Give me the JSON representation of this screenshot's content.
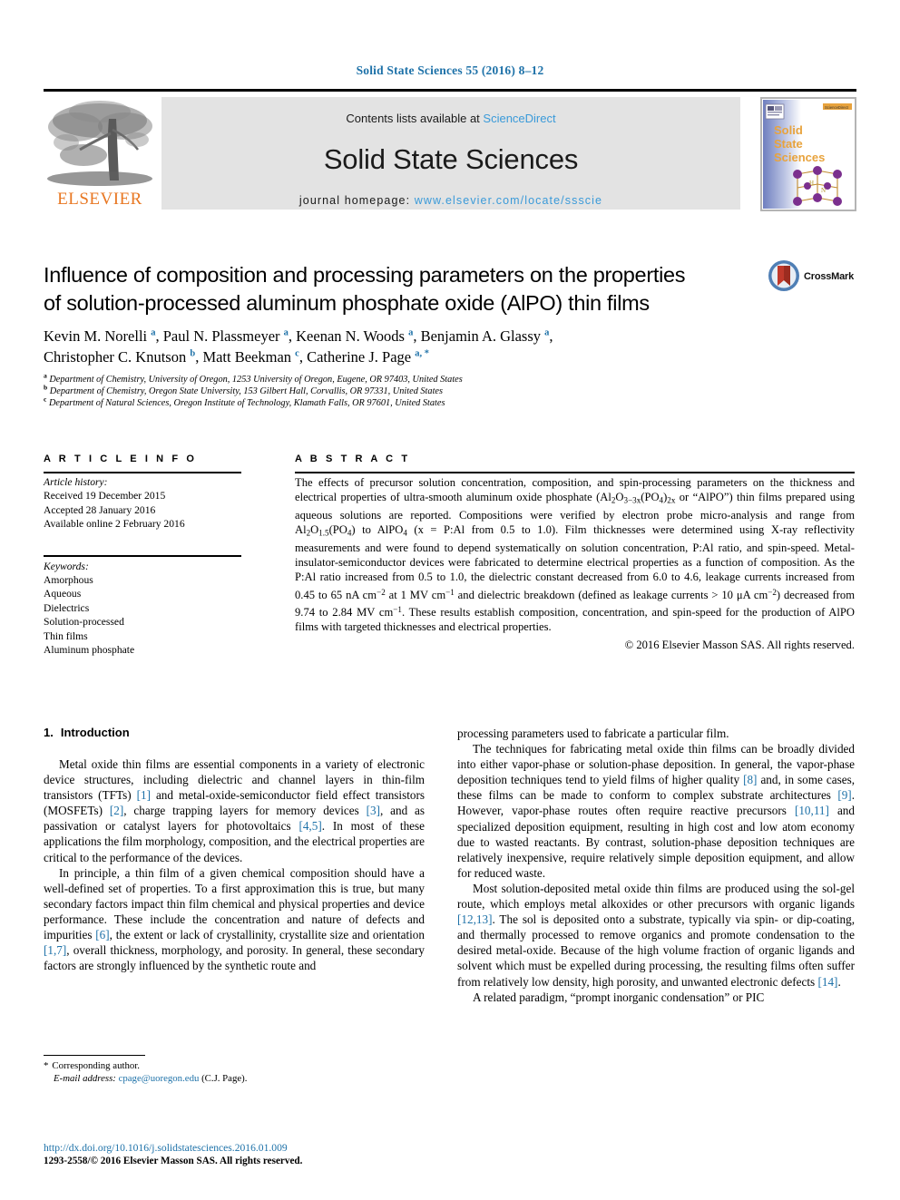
{
  "running_head": "Solid State Sciences 55 (2016) 8–12",
  "banner": {
    "contents_prefix": "Contents lists available at ",
    "sciencedirect": "ScienceDirect",
    "journal_name": "Solid State Sciences",
    "homepage_prefix": "journal homepage: ",
    "homepage_url": "www.elsevier.com/locate/ssscie",
    "publisher": "ELSEVIER",
    "cover_title_lines": [
      "Solid",
      "State",
      "Sciences"
    ],
    "link_color": "#3a9ad9",
    "publisher_color": "#e87722"
  },
  "article": {
    "title_line1": "Influence of composition and processing parameters on the properties",
    "title_line2": "of solution-processed aluminum phosphate oxide (AlPO) thin films",
    "crossmark_label": "CrossMark",
    "authors_line1": "Kevin M. Norelli <sup>a</sup>, Paul N. Plassmeyer <sup>a</sup>, Keenan N. Woods <sup>a</sup>, Benjamin A. Glassy <sup>a</sup>,",
    "authors_line2": "Christopher C. Knutson <sup>b</sup>, Matt Beekman <sup>c</sup>, Catherine J. Page <sup>a, *</sup>",
    "affiliations": [
      "<sup>a</sup> Department of Chemistry, University of Oregon, 1253 University of Oregon, Eugene, OR 97403, United States",
      "<sup>b</sup> Department of Chemistry, Oregon State University, 153 Gilbert Hall, Corvallis, OR 97331, United States",
      "<sup>c</sup> Department of Natural Sciences, Oregon Institute of Technology, Klamath Falls, OR 97601, United States"
    ]
  },
  "article_info": {
    "heading": "A R T I C L E  I N F O",
    "history_label": "Article history:",
    "history": [
      "Received 19 December 2015",
      "Accepted 28 January 2016",
      "Available online 2 February 2016"
    ],
    "keywords_label": "Keywords:",
    "keywords": [
      "Amorphous",
      "Aqueous",
      "Dielectrics",
      "Solution-processed",
      "Thin films",
      "Aluminum phosphate"
    ]
  },
  "abstract": {
    "heading": "A B S T R A C T",
    "body": "The effects of precursor solution concentration, composition, and spin-processing parameters on the thickness and electrical properties of ultra-smooth aluminum oxide phosphate (Al<sub>2</sub>O<sub>3&minus;3x</sub>(PO<sub>4</sub>)<sub>2x</sub> or “AlPO”) thin films prepared using aqueous solutions are reported. Compositions were verified by electron probe micro-analysis and range from Al<sub>2</sub>O<sub>1.5</sub>(PO<sub>4</sub>) to AlPO<sub>4</sub> (x = P:Al from 0.5 to 1.0). Film thicknesses were determined using X-ray reflectivity measurements and were found to depend systematically on solution concentration, P:Al ratio, and spin-speed. Metal-insulator-semiconductor devices were fabricated to determine electrical properties as a function of composition. As the P:Al ratio increased from 0.5 to 1.0, the dielectric constant decreased from 6.0 to 4.6, leakage currents increased from 0.45 to 65 nA cm<sup class=\"num\">&minus;2</sup> at 1 MV cm<sup class=\"num\">&minus;1</sup> and dielectric breakdown (defined as leakage currents > 10 μA cm<sup class=\"num\">&minus;2</sup>) decreased from 9.74 to 2.84 MV cm<sup class=\"num\">&minus;1</sup>. These results establish composition, concentration, and spin-speed for the production of AlPO films with targeted thicknesses and electrical properties.",
    "copyright": "© 2016 Elsevier Masson SAS. All rights reserved."
  },
  "section": {
    "number": "1.",
    "heading": "Introduction"
  },
  "paragraphs_left": [
    "Metal oxide thin films are essential components in a variety of electronic device structures, including dielectric and channel layers in thin-film transistors (TFTs) <span class=\"ref\">[1]</span> and metal-oxide-semiconductor field effect transistors (MOSFETs) <span class=\"ref\">[2]</span>, charge trapping layers for memory devices <span class=\"ref\">[3]</span>, and as passivation or catalyst layers for photovoltaics <span class=\"ref\">[4,5]</span>. In most of these applications the film morphology, composition, and the electrical properties are critical to the performance of the devices.",
    "In principle, a thin film of a given chemical composition should have a well-defined set of properties. To a first approximation this is true, but many secondary factors impact thin film chemical and physical properties and device performance. These include the concentration and nature of defects and impurities <span class=\"ref\">[6]</span>, the extent or lack of crystallinity, crystallite size and orientation <span class=\"ref\">[1,7]</span>, overall thickness, morphology, and porosity. In general, these secondary factors are strongly influenced by the synthetic route and"
  ],
  "paragraphs_right": [
    "processing parameters used to fabricate a particular film.",
    "The techniques for fabricating metal oxide thin films can be broadly divided into either vapor-phase or solution-phase deposition. In general, the vapor-phase deposition techniques tend to yield films of higher quality <span class=\"ref\">[8]</span> and, in some cases, these films can be made to conform to complex substrate architectures <span class=\"ref\">[9]</span>. However, vapor-phase routes often require reactive precursors <span class=\"ref\">[10,11]</span> and specialized deposition equipment, resulting in high cost and low atom economy due to wasted reactants. By contrast, solution-phase deposition techniques are relatively inexpensive, require relatively simple deposition equipment, and allow for reduced waste.",
    "Most solution-deposited metal oxide thin films are produced using the sol-gel route, which employs metal alkoxides or other precursors with organic ligands <span class=\"ref\">[12,13]</span>. The sol is deposited onto a substrate, typically via spin- or dip-coating, and thermally processed to remove organics and promote condensation to the desired metal-oxide. Because of the high volume fraction of organic ligands and solvent which must be expelled during processing, the resulting films often suffer from relatively low density, high porosity, and unwanted electronic defects <span class=\"ref\">[14]</span>.",
    "A related paradigm, “prompt inorganic condensation” or PIC"
  ],
  "footnote": {
    "star": "*",
    "corresponding": "Corresponding author.",
    "email_label": "E-mail address:",
    "email": "cpage@uoregon.edu",
    "email_suffix": "(C.J. Page)."
  },
  "footer": {
    "doi": "http://dx.doi.org/10.1016/j.solidstatesciences.2016.01.009",
    "issn_line": "1293-2558/© 2016 Elsevier Masson SAS. All rights reserved."
  },
  "colors": {
    "link": "#1d71a8",
    "elsevier_orange": "#e87722",
    "banner_bg": "#e3e3e3"
  }
}
